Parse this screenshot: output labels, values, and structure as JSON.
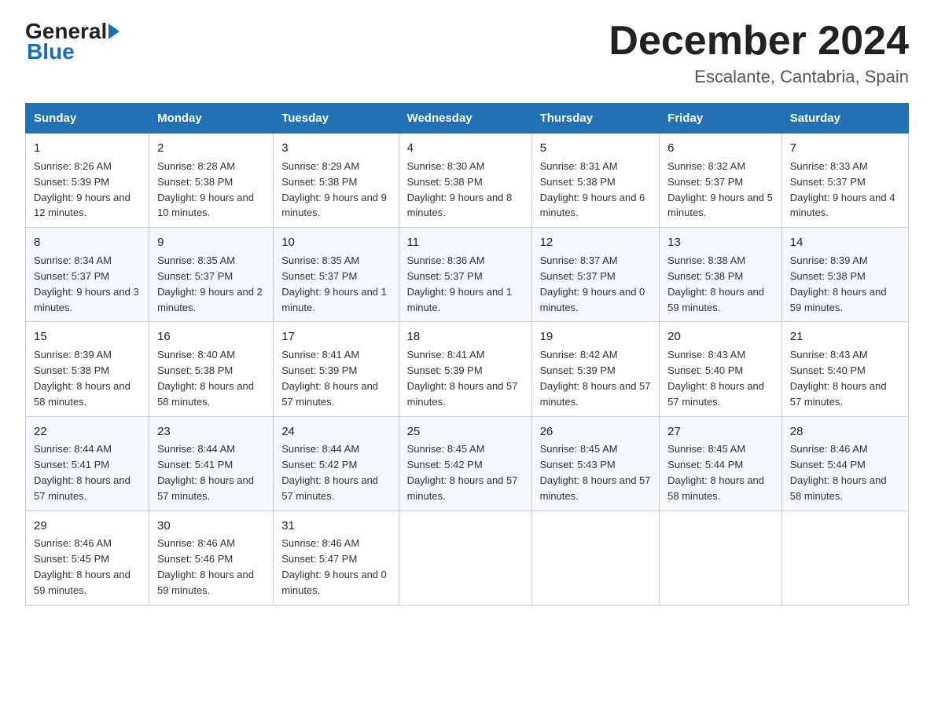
{
  "header": {
    "logo_general": "General",
    "logo_blue": "Blue",
    "month_title": "December 2024",
    "location": "Escalante, Cantabria, Spain"
  },
  "days_of_week": [
    "Sunday",
    "Monday",
    "Tuesday",
    "Wednesday",
    "Thursday",
    "Friday",
    "Saturday"
  ],
  "weeks": [
    [
      {
        "day": "1",
        "sunrise": "8:26 AM",
        "sunset": "5:39 PM",
        "daylight": "9 hours and 12 minutes."
      },
      {
        "day": "2",
        "sunrise": "8:28 AM",
        "sunset": "5:38 PM",
        "daylight": "9 hours and 10 minutes."
      },
      {
        "day": "3",
        "sunrise": "8:29 AM",
        "sunset": "5:38 PM",
        "daylight": "9 hours and 9 minutes."
      },
      {
        "day": "4",
        "sunrise": "8:30 AM",
        "sunset": "5:38 PM",
        "daylight": "9 hours and 8 minutes."
      },
      {
        "day": "5",
        "sunrise": "8:31 AM",
        "sunset": "5:38 PM",
        "daylight": "9 hours and 6 minutes."
      },
      {
        "day": "6",
        "sunrise": "8:32 AM",
        "sunset": "5:37 PM",
        "daylight": "9 hours and 5 minutes."
      },
      {
        "day": "7",
        "sunrise": "8:33 AM",
        "sunset": "5:37 PM",
        "daylight": "9 hours and 4 minutes."
      }
    ],
    [
      {
        "day": "8",
        "sunrise": "8:34 AM",
        "sunset": "5:37 PM",
        "daylight": "9 hours and 3 minutes."
      },
      {
        "day": "9",
        "sunrise": "8:35 AM",
        "sunset": "5:37 PM",
        "daylight": "9 hours and 2 minutes."
      },
      {
        "day": "10",
        "sunrise": "8:35 AM",
        "sunset": "5:37 PM",
        "daylight": "9 hours and 1 minute."
      },
      {
        "day": "11",
        "sunrise": "8:36 AM",
        "sunset": "5:37 PM",
        "daylight": "9 hours and 1 minute."
      },
      {
        "day": "12",
        "sunrise": "8:37 AM",
        "sunset": "5:37 PM",
        "daylight": "9 hours and 0 minutes."
      },
      {
        "day": "13",
        "sunrise": "8:38 AM",
        "sunset": "5:38 PM",
        "daylight": "8 hours and 59 minutes."
      },
      {
        "day": "14",
        "sunrise": "8:39 AM",
        "sunset": "5:38 PM",
        "daylight": "8 hours and 59 minutes."
      }
    ],
    [
      {
        "day": "15",
        "sunrise": "8:39 AM",
        "sunset": "5:38 PM",
        "daylight": "8 hours and 58 minutes."
      },
      {
        "day": "16",
        "sunrise": "8:40 AM",
        "sunset": "5:38 PM",
        "daylight": "8 hours and 58 minutes."
      },
      {
        "day": "17",
        "sunrise": "8:41 AM",
        "sunset": "5:39 PM",
        "daylight": "8 hours and 57 minutes."
      },
      {
        "day": "18",
        "sunrise": "8:41 AM",
        "sunset": "5:39 PM",
        "daylight": "8 hours and 57 minutes."
      },
      {
        "day": "19",
        "sunrise": "8:42 AM",
        "sunset": "5:39 PM",
        "daylight": "8 hours and 57 minutes."
      },
      {
        "day": "20",
        "sunrise": "8:43 AM",
        "sunset": "5:40 PM",
        "daylight": "8 hours and 57 minutes."
      },
      {
        "day": "21",
        "sunrise": "8:43 AM",
        "sunset": "5:40 PM",
        "daylight": "8 hours and 57 minutes."
      }
    ],
    [
      {
        "day": "22",
        "sunrise": "8:44 AM",
        "sunset": "5:41 PM",
        "daylight": "8 hours and 57 minutes."
      },
      {
        "day": "23",
        "sunrise": "8:44 AM",
        "sunset": "5:41 PM",
        "daylight": "8 hours and 57 minutes."
      },
      {
        "day": "24",
        "sunrise": "8:44 AM",
        "sunset": "5:42 PM",
        "daylight": "8 hours and 57 minutes."
      },
      {
        "day": "25",
        "sunrise": "8:45 AM",
        "sunset": "5:42 PM",
        "daylight": "8 hours and 57 minutes."
      },
      {
        "day": "26",
        "sunrise": "8:45 AM",
        "sunset": "5:43 PM",
        "daylight": "8 hours and 57 minutes."
      },
      {
        "day": "27",
        "sunrise": "8:45 AM",
        "sunset": "5:44 PM",
        "daylight": "8 hours and 58 minutes."
      },
      {
        "day": "28",
        "sunrise": "8:46 AM",
        "sunset": "5:44 PM",
        "daylight": "8 hours and 58 minutes."
      }
    ],
    [
      {
        "day": "29",
        "sunrise": "8:46 AM",
        "sunset": "5:45 PM",
        "daylight": "8 hours and 59 minutes."
      },
      {
        "day": "30",
        "sunrise": "8:46 AM",
        "sunset": "5:46 PM",
        "daylight": "8 hours and 59 minutes."
      },
      {
        "day": "31",
        "sunrise": "8:46 AM",
        "sunset": "5:47 PM",
        "daylight": "9 hours and 0 minutes."
      },
      null,
      null,
      null,
      null
    ]
  ]
}
